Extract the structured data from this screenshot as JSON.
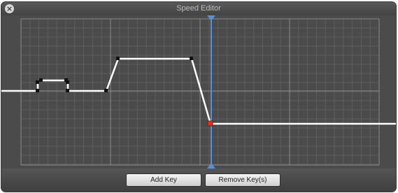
{
  "window": {
    "title": "Speed Editor"
  },
  "buttons": {
    "add_key": "Add Key",
    "remove_keys": "Remove Key(s)"
  },
  "colors": {
    "background": "#4b4b4b",
    "grid_minor": "#5e5e5e",
    "grid_major": "#8a8a8a",
    "curve": "#ffffff",
    "keyframe": "#111111",
    "selected_keyframe": "#e0321e",
    "playhead": "#5b8fd3"
  },
  "icons": {
    "close": "close-icon",
    "playhead_top": "playhead-top-arrow-icon",
    "playhead_bottom": "playhead-bottom-arrow-icon"
  }
}
